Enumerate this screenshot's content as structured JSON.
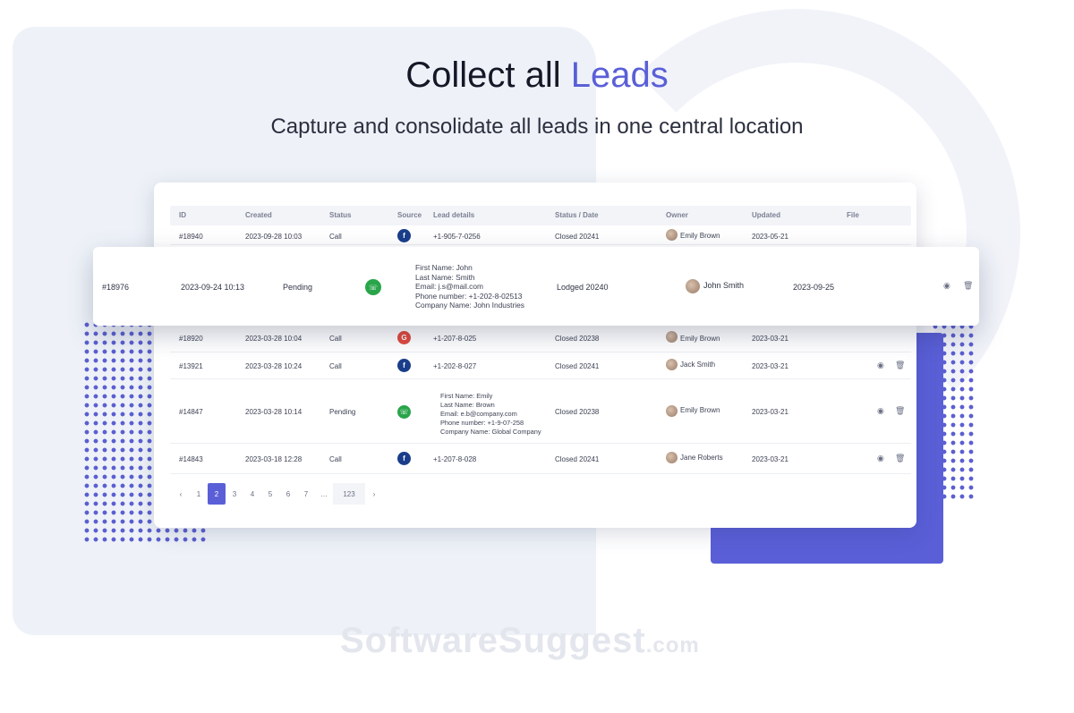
{
  "hero": {
    "title_main": "Collect all ",
    "title_accent": "Leads",
    "subtitle": "Capture and consolidate all leads in one central location"
  },
  "table": {
    "columns": [
      "ID",
      "Created",
      "Status",
      "Source",
      "Lead details",
      "Status / Date",
      "Owner",
      "Updated",
      "File"
    ],
    "rows": [
      {
        "id": "#18940",
        "created": "2023-09-28 10:03",
        "status": "Call",
        "source": "facebook",
        "details": [
          "+1-905-7-0256"
        ],
        "status_date": "Closed 20241",
        "owner": "Emily Brown",
        "updated": "2023-05-21"
      },
      {
        "id": "#18920",
        "created": "2023-03-28 10:04",
        "status": "Call",
        "source": "google",
        "details": [
          "+1-207-8-025"
        ],
        "status_date": "Closed 20238",
        "owner": "Emily Brown",
        "updated": "2023-03-21"
      },
      {
        "id": "#13921",
        "created": "2023-03-28 10:24",
        "status": "Call",
        "source": "facebook",
        "details": [
          "+1-202-8-027"
        ],
        "status_date": "Closed 20241",
        "owner": "Jack Smith",
        "updated": "2023-03-21"
      },
      {
        "id": "#14847",
        "created": "2023-03-28 10:14",
        "status": "Pending",
        "source": "whatsapp",
        "details": [
          "First Name: Emily",
          "Last Name: Brown",
          "Email: e.b@company.com",
          "Phone number: +1-9-07-258",
          "Company Name: Global Company"
        ],
        "status_date": "Closed 20238",
        "owner": "Emily Brown",
        "updated": "2023-03-21"
      },
      {
        "id": "#14843",
        "created": "2023-03-18 12:28",
        "status": "Call",
        "source": "facebook",
        "details": [
          "+1-207-8-028"
        ],
        "status_date": "Closed 20241",
        "owner": "Jane Roberts",
        "updated": "2023-03-21"
      }
    ],
    "highlight": {
      "id": "#18976",
      "created": "2023-09-24 10:13",
      "status": "Pending",
      "source": "whatsapp",
      "details": [
        "First Name: John",
        "Last Name: Smith",
        "Email: j.s@mail.com",
        "Phone number: +1-202-8-02513",
        "Company Name: John Industries"
      ],
      "status_date": "Lodged 20240",
      "owner": "John Smith",
      "updated": "2023-09-25"
    }
  },
  "pagination": {
    "prev": "‹",
    "pages": [
      "1",
      "2",
      "3",
      "4",
      "5",
      "6",
      "7"
    ],
    "ellipsis": "…",
    "last": "123",
    "next": "›",
    "active_index": 1
  },
  "watermark": {
    "main": "SoftwareSuggest",
    "suffix": ".com"
  },
  "icons": {
    "view": "eye-icon",
    "delete": "trash-icon"
  },
  "colors": {
    "accent": "#5a5fd8",
    "facebook": "#1a3e8a",
    "whatsapp": "#2aa54a",
    "google": "#e0493d"
  }
}
